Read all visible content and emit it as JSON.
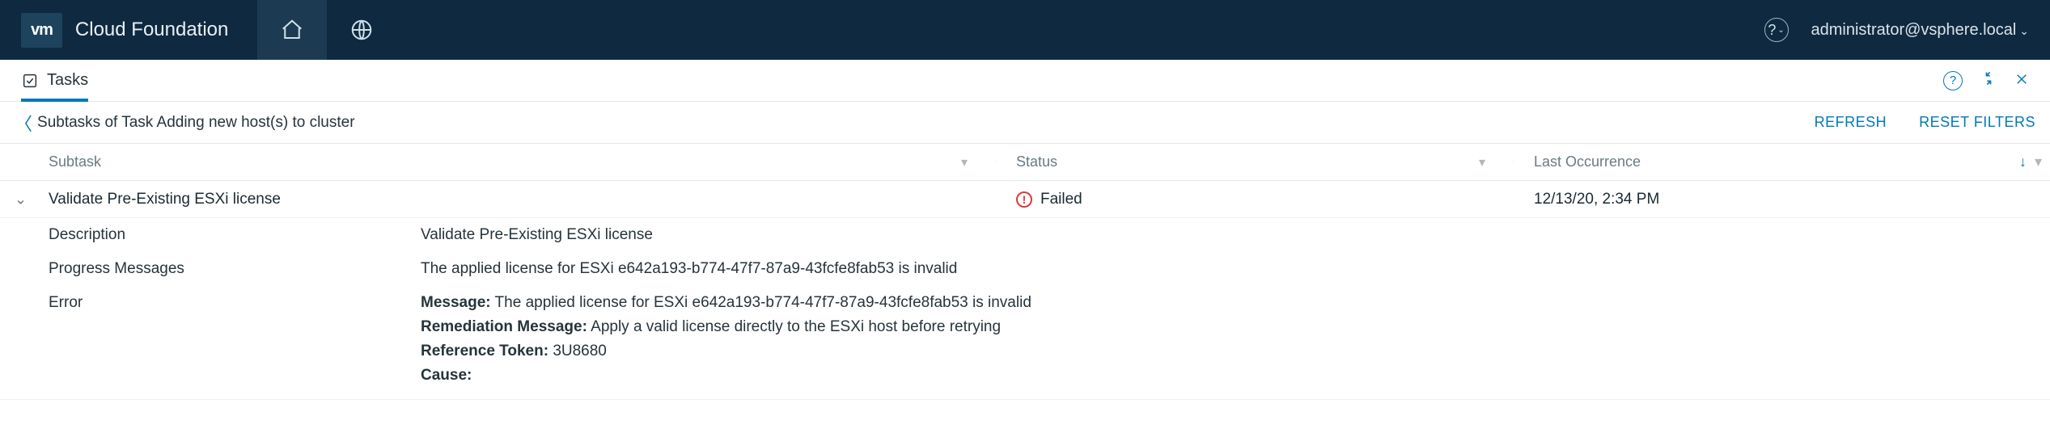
{
  "header": {
    "brand_badge": "vm",
    "brand_title": "Cloud Foundation",
    "user": "administrator@vsphere.local"
  },
  "tabs": {
    "tasks_label": "Tasks"
  },
  "subheader": {
    "breadcrumb": "Subtasks of Task Adding new host(s) to cluster",
    "refresh": "REFRESH",
    "reset_filters": "RESET FILTERS"
  },
  "columns": {
    "subtask": "Subtask",
    "status": "Status",
    "last_occurrence": "Last Occurrence"
  },
  "row": {
    "subtask": "Validate Pre-Existing ESXi license",
    "status": "Failed",
    "last_occurrence": "12/13/20, 2:34 PM"
  },
  "details": {
    "description_label": "Description",
    "description_value": "Validate Pre-Existing ESXi license",
    "progress_label": "Progress Messages",
    "progress_value": "The applied license for ESXi e642a193-b774-47f7-87a9-43fcfe8fab53 is invalid",
    "error_label": "Error",
    "message_label": "Message:",
    "message_value": "The applied license for ESXi e642a193-b774-47f7-87a9-43fcfe8fab53 is invalid",
    "remediation_label": "Remediation Message:",
    "remediation_value": "Apply a valid license directly to the ESXi host before retrying",
    "reference_label": "Reference Token:",
    "reference_value": "3U8680",
    "cause_label": "Cause:",
    "cause_value": ""
  }
}
